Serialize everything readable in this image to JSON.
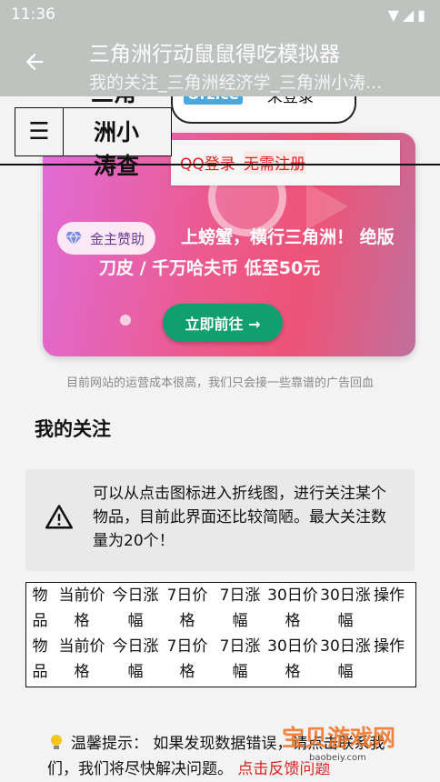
{
  "status_bar": {
    "time": "11:36"
  },
  "app_bar": {
    "title": "三角洲行动鼠鼠得吃模拟器",
    "subtitle": "我的关注_三角洲经济学_三角洲小涛..."
  },
  "site_header": {
    "brand_partial": "三角",
    "brand": "洲小涛查",
    "login_logo": "Orzice",
    "login_status": "未登录",
    "qq_login": "QQ登录",
    "no_register": "无需注册"
  },
  "ad": {
    "sponsor_label": "金主赞助",
    "headline": "上螃蟹，横行三角洲！ 绝版刀皮 / 千万哈夫币 低至50元",
    "cta": "立即前往 →",
    "note": "目前网站的运营成本很高，我们只会接一些靠谱的广告回血"
  },
  "follow": {
    "title": "我的关注",
    "notice": "可以从点击图标进入折线图，进行关注某个物品，目前此界面还比较简陋。最大关注数量为20个！",
    "columns": [
      "物品",
      "当前价格",
      "今日涨幅",
      "7日价格",
      "7日涨幅",
      "30日价格",
      "30日涨幅",
      "操作"
    ]
  },
  "tip": {
    "label": "温馨提示：",
    "text": "如果发现数据错误，请点击联系我们，我们将尽快解决问题。",
    "link": "点击反馈问题"
  },
  "watermark": {
    "text": "宝贝游戏网",
    "url": "baobeiy.com"
  },
  "colors": {
    "accent_red": "#e02020",
    "cta_green": "#10a070",
    "header_gray": "#bfc3bf"
  }
}
